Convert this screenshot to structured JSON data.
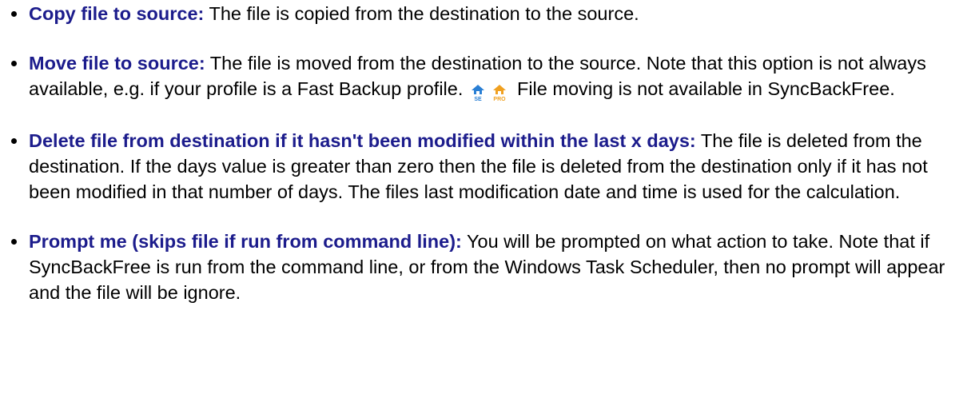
{
  "items": [
    {
      "term": "Copy file to source:",
      "description": " The file is copied from the destination to the source."
    },
    {
      "term": "Move file to source:",
      "description": " The file is moved from the destination to the source. Note that this option is not always available, e.g. if your profile is a Fast Backup profile.",
      "description_after_icons": " File moving is not available in SyncBackFree.",
      "icons": [
        "syncback-se-icon",
        "syncback-pro-icon"
      ]
    },
    {
      "term": "Delete file from destination if it hasn't been modified within the last x days:",
      "description": " The file is deleted from the destination. If the days value is greater than zero then the file is deleted from the destination only if it has not been modified in that number of days. The files last modification date and time is used for the calculation."
    },
    {
      "term": "Prompt me (skips file if run from command line):",
      "description": " You will be prompted on what action to take. Note that if SyncBackFree is run from the command line, or from the Windows Task Scheduler, then no prompt will appear and the file will be ignore."
    }
  ],
  "colors": {
    "term": "#1c1c8c",
    "text": "#000000",
    "se_icon": "#2a7fd4",
    "pro_icon": "#f0a020"
  }
}
